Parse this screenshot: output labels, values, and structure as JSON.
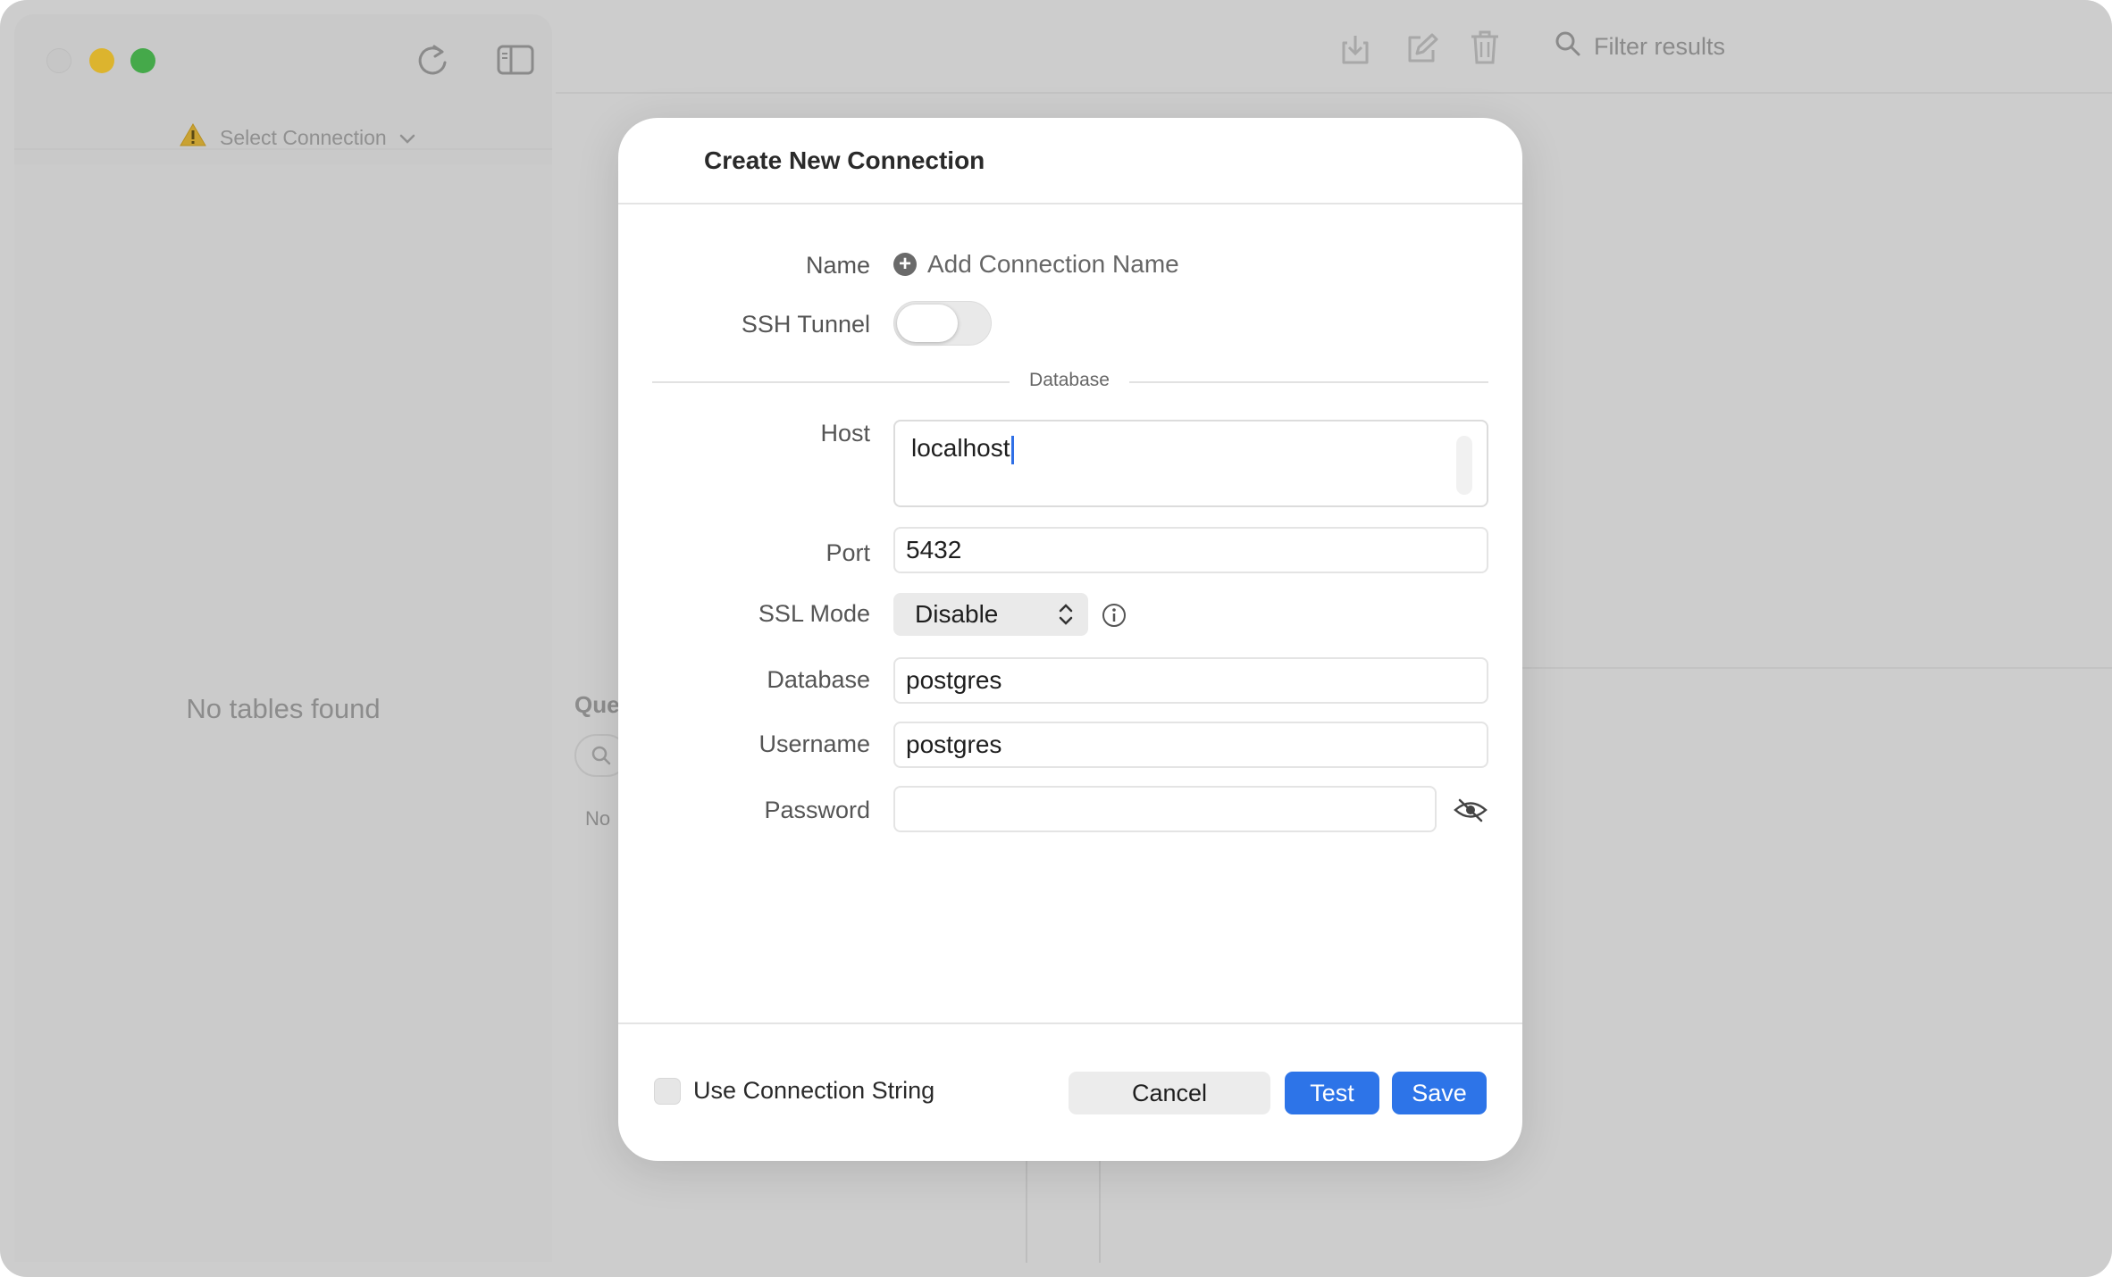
{
  "sidebar": {
    "select_connection": "Select Connection",
    "empty_message": "No tables found"
  },
  "toolbar": {
    "filter_placeholder": "Filter results"
  },
  "queries": {
    "title": "Que",
    "empty": "No"
  },
  "modal": {
    "title": "Create New Connection",
    "labels": {
      "name": "Name",
      "ssh_tunnel": "SSH Tunnel",
      "section": "Database",
      "host": "Host",
      "port": "Port",
      "ssl_mode": "SSL Mode",
      "database": "Database",
      "username": "Username",
      "password": "Password"
    },
    "add_name": "Add Connection Name",
    "ssh_tunnel_on": false,
    "values": {
      "host": "localhost",
      "port": "5432",
      "ssl_mode": "Disable",
      "database": "postgres",
      "username": "postgres",
      "password": ""
    },
    "use_connection_string": "Use Connection String",
    "buttons": {
      "cancel": "Cancel",
      "test": "Test",
      "save": "Save"
    }
  },
  "colors": {
    "accent": "#2d74e8",
    "traffic_min": "#dcb42e",
    "traffic_max": "#45a94a"
  }
}
